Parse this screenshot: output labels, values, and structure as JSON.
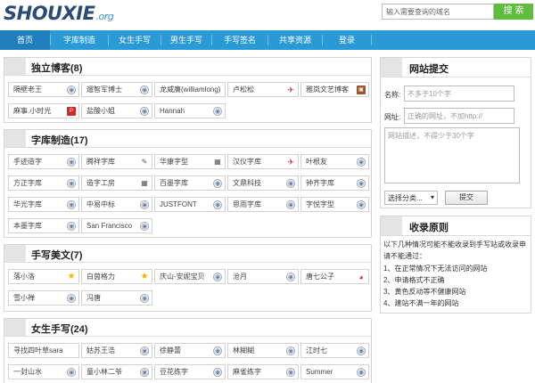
{
  "header": {
    "logo_main": "SHOUXIE",
    "logo_org": ".org",
    "search_placeholder": "输入需要查询的域名",
    "search_button": "搜 索"
  },
  "nav": [
    "首页",
    "字库制造",
    "女生手写",
    "男生手写",
    "手写签名",
    "共享资源",
    "登录"
  ],
  "sections": [
    {
      "title": "独立博客(8)",
      "items": [
        {
          "label": "隔壁老王",
          "icon": "circle-icon"
        },
        {
          "label": "遛智军博士",
          "icon": "circle-icon"
        },
        {
          "label": "龙威廉(williamlong)",
          "icon": "circle-icon"
        },
        {
          "label": "卢松松",
          "icon": "bird-icon"
        },
        {
          "label": "雅岚文艺博客",
          "icon": "face-icon"
        },
        {
          "label": "麻事.小时光",
          "icon": "red-square-icon"
        },
        {
          "label": "盐酸小姐",
          "icon": "circle-icon"
        },
        {
          "label": "Hannah",
          "icon": "circle-icon"
        }
      ]
    },
    {
      "title": "字库制造(17)",
      "items": [
        {
          "label": "手迹造字",
          "icon": "circle-icon"
        },
        {
          "label": "腾祥字库",
          "icon": "brush-icon"
        },
        {
          "label": "华康字型",
          "icon": "brush-icon"
        },
        {
          "label": "汉仪字库",
          "icon": "bird-icon"
        },
        {
          "label": "叶根友",
          "icon": "circle-icon"
        },
        {
          "label": "方正字库",
          "icon": "circle-icon"
        },
        {
          "label": "造字工房",
          "icon": "brush-icon"
        },
        {
          "label": "百墨字库",
          "icon": "circle-icon"
        },
        {
          "label": "文鼎科技",
          "icon": "circle-icon"
        },
        {
          "label": "钟齐字库",
          "icon": "circle-icon"
        },
        {
          "label": "华光字库",
          "icon": "circle-icon"
        },
        {
          "label": "中易中标",
          "icon": "circle-icon"
        },
        {
          "label": "JUSTFONT",
          "icon": "circle-icon"
        },
        {
          "label": "思雨字库",
          "icon": "circle-icon"
        },
        {
          "label": "字悦字型",
          "icon": "circle-icon"
        },
        {
          "label": "本墨字库",
          "icon": "circle-icon"
        },
        {
          "label": "San Francisco",
          "icon": "circle-icon"
        }
      ]
    },
    {
      "title": "手写美文(7)",
      "items": [
        {
          "label": "落小洛",
          "icon": "star-icon"
        },
        {
          "label": "白茵格力",
          "icon": "star-icon"
        },
        {
          "label": "庆山-安妮宝贝",
          "icon": "circle-icon"
        },
        {
          "label": "沧月",
          "icon": "circle-icon"
        },
        {
          "label": "唐七公子",
          "icon": "weibo-icon"
        },
        {
          "label": "雪小禅",
          "icon": "circle-icon"
        },
        {
          "label": "冯唐",
          "icon": "circle-icon"
        }
      ]
    },
    {
      "title": "女生手写(24)",
      "items": [
        {
          "label": "寻找四叶草sara",
          "icon": "circle-icon"
        },
        {
          "label": "姑苏王浩",
          "icon": "circle-icon"
        },
        {
          "label": "徐静蕾",
          "icon": "circle-icon"
        },
        {
          "label": "林糊糊",
          "icon": "circle-icon"
        },
        {
          "label": "江时七",
          "icon": "circle-icon"
        },
        {
          "label": "一封山水",
          "icon": "circle-icon"
        },
        {
          "label": "童小林二爷",
          "icon": "circle-icon"
        },
        {
          "label": "豆花练字",
          "icon": "circle-icon"
        },
        {
          "label": "麻雀练字",
          "icon": "circle-icon"
        },
        {
          "label": "Summer",
          "icon": "circle-icon"
        }
      ]
    }
  ],
  "submit_panel": {
    "title": "网站提交",
    "name_label": "名称:",
    "name_placeholder": "不多于10个字",
    "url_label": "网址:",
    "url_placeholder": "正确的网址，不加http://",
    "desc_placeholder": "网站描述，不得少于30个字",
    "category_label": "选择分类...",
    "submit_label": "提交"
  },
  "rules_panel": {
    "title": "收录原则",
    "intro": "以下几种情况可能不能收录到手写站或收录申请不能通过：",
    "rules": [
      "1、在正常情况下无法访问的网站",
      "2、申请格式不正确",
      "3、黄色反动等不健康网站",
      "4、建站不满一年的网站"
    ]
  },
  "colors": {
    "nav_bg": "#2a9ad7",
    "search_button": "#5ebd3c",
    "logo": "#2a4b73"
  }
}
